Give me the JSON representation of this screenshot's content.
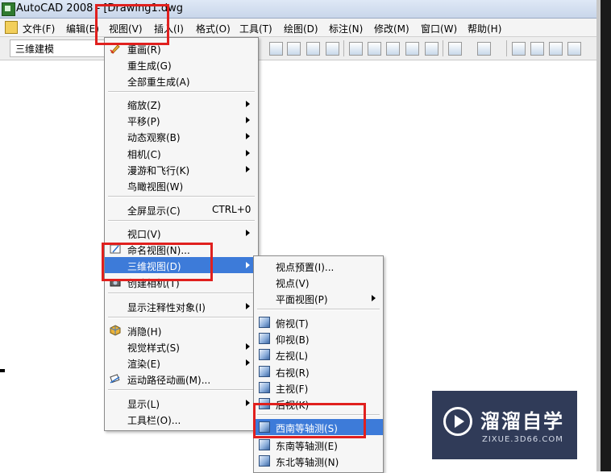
{
  "title_bar": {
    "app": "AutoCAD 2008 -",
    "document": "[Drawing1.dwg"
  },
  "menu_bar": {
    "items": [
      "文件(F)",
      "编辑(E)",
      "视图(V)",
      "插入(I)",
      "格式(O)",
      "工具(T)",
      "绘图(D)",
      "标注(N)",
      "修改(M)",
      "窗口(W)",
      "帮助(H)"
    ]
  },
  "toolbar": {
    "workspace": "三维建模"
  },
  "view_menu": {
    "items": [
      {
        "label": "重画(R)"
      },
      {
        "label": "重生成(G)"
      },
      {
        "label": "全部重生成(A)"
      },
      {
        "label": "缩放(Z)",
        "submenu": true
      },
      {
        "label": "平移(P)",
        "submenu": true
      },
      {
        "label": "动态观察(B)",
        "submenu": true
      },
      {
        "label": "相机(C)",
        "submenu": true
      },
      {
        "label": "漫游和飞行(K)",
        "submenu": true
      },
      {
        "label": "鸟瞰视图(W)"
      },
      {
        "label": "全屏显示(C)",
        "shortcut": "CTRL+0"
      },
      {
        "label": "视口(V)",
        "submenu": true
      },
      {
        "label": "命名视图(N)..."
      },
      {
        "label": "三维视图(D)",
        "submenu": true,
        "highlighted": true
      },
      {
        "label": "创建相机(T)"
      },
      {
        "label": "显示注释性对象(I)",
        "submenu": true
      },
      {
        "label": "消隐(H)"
      },
      {
        "label": "视觉样式(S)",
        "submenu": true
      },
      {
        "label": "渲染(E)",
        "submenu": true
      },
      {
        "label": "运动路径动画(M)..."
      },
      {
        "label": "显示(L)",
        "submenu": true
      },
      {
        "label": "工具栏(O)..."
      }
    ]
  },
  "three_d_submenu": {
    "items": [
      {
        "label": "视点预置(I)..."
      },
      {
        "label": "视点(V)"
      },
      {
        "label": "平面视图(P)",
        "submenu": true
      },
      {
        "label": "俯视(T)"
      },
      {
        "label": "仰视(B)"
      },
      {
        "label": "左视(L)"
      },
      {
        "label": "右视(R)"
      },
      {
        "label": "主视(F)"
      },
      {
        "label": "后视(K)"
      },
      {
        "label": "西南等轴测(S)",
        "highlighted": true
      },
      {
        "label": "东南等轴测(E)"
      },
      {
        "label": "东北等轴测(N)"
      }
    ]
  },
  "watermark": {
    "title": "溜溜自学",
    "subtitle": "ZIXUE.3D66.COM"
  },
  "colors": {
    "highlight": "#3d7bd9",
    "annotation_box": "#e0201e",
    "menu_bg": "#f6f6f6"
  }
}
